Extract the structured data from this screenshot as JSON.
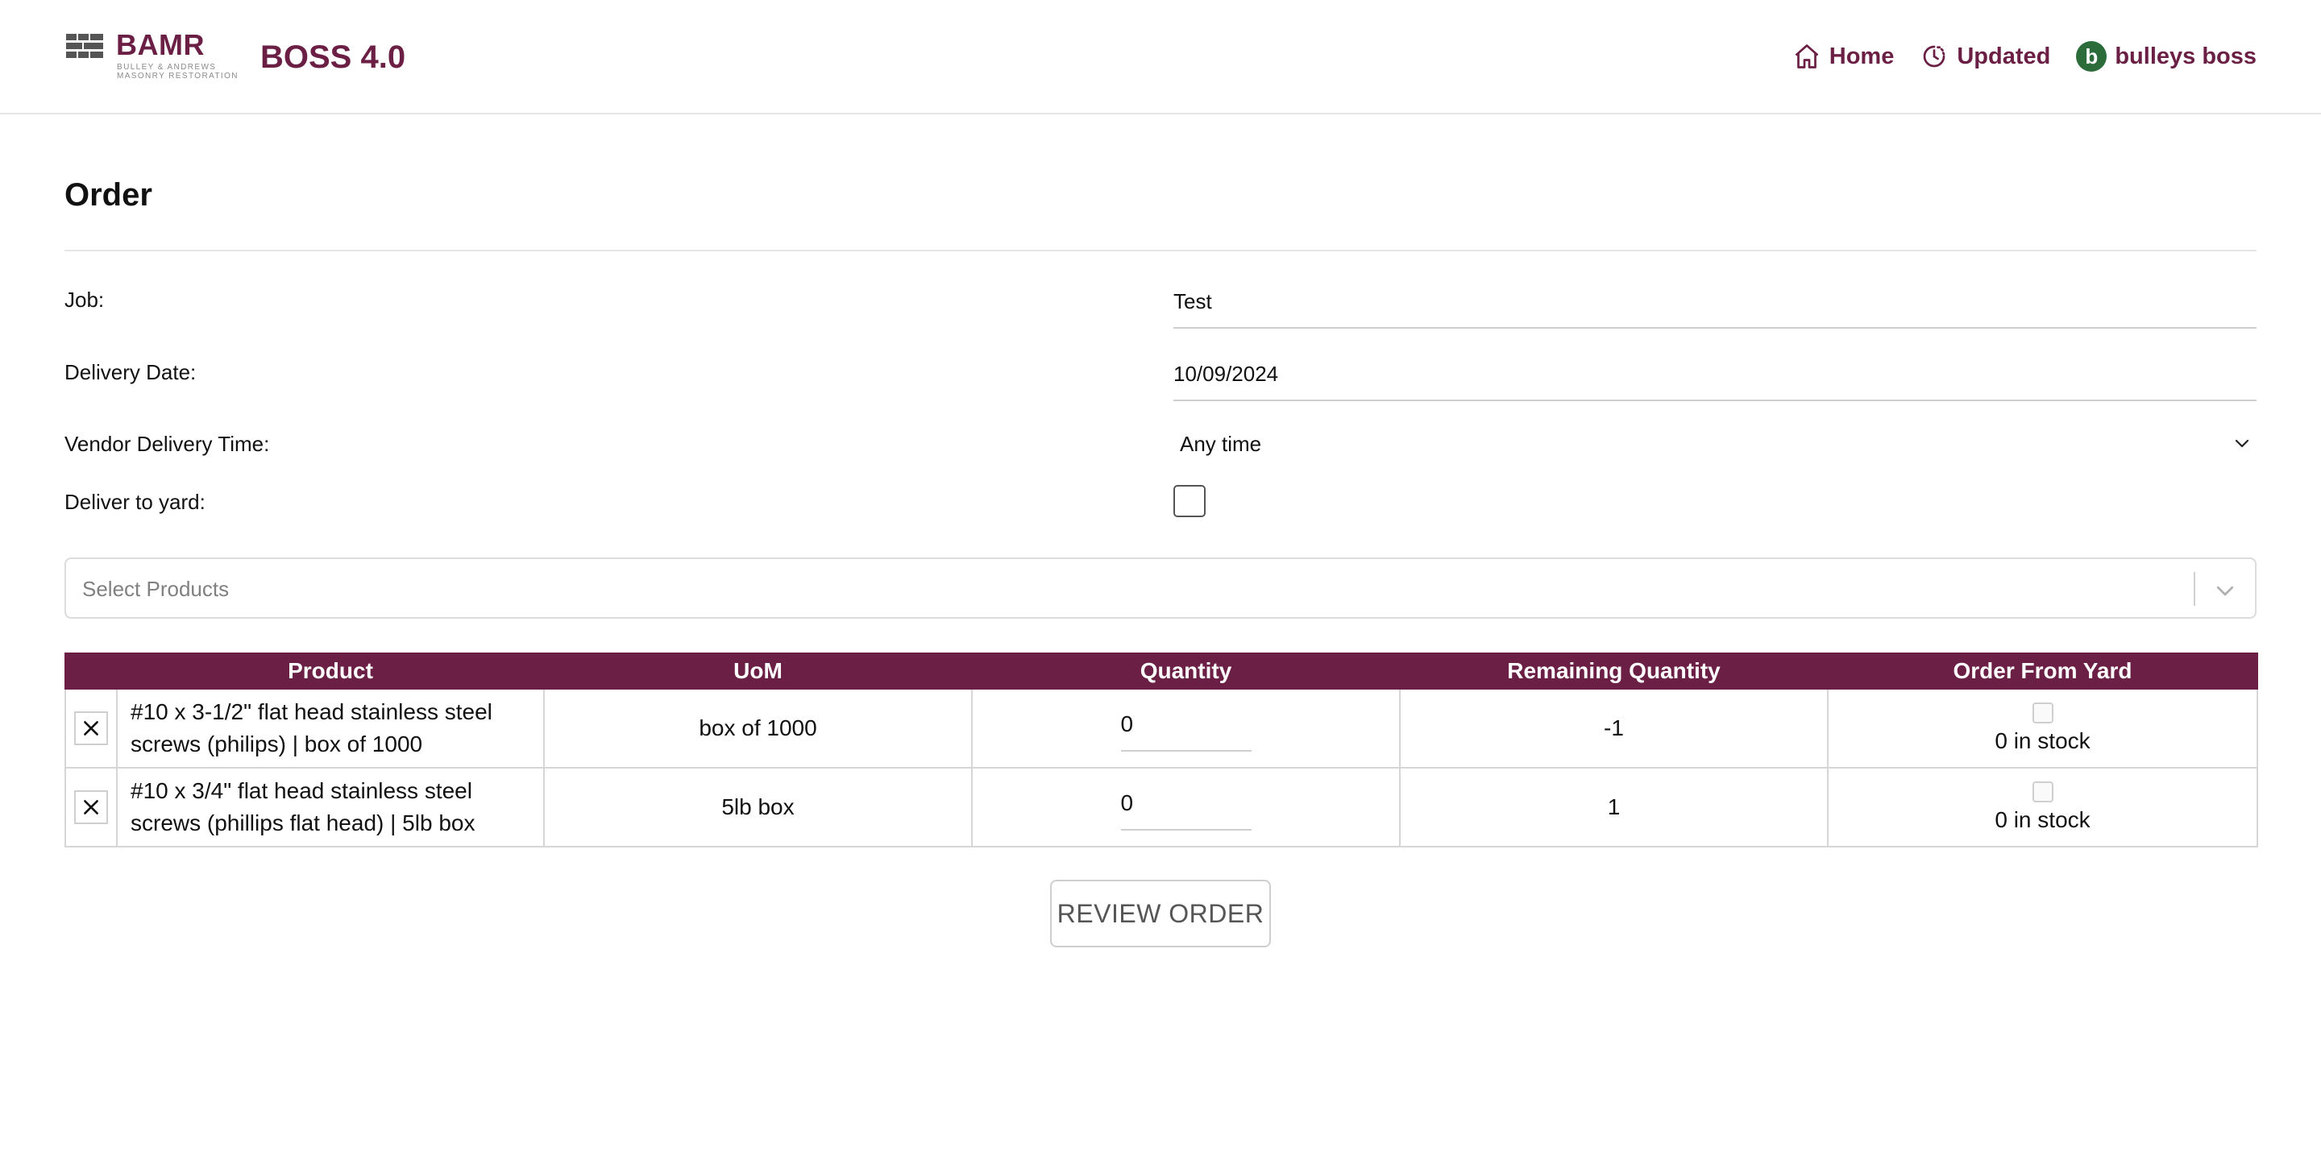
{
  "header": {
    "logo_text": "BAMR",
    "logo_sub1": "BULLEY & ANDREWS",
    "logo_sub2": "MASONRY RESTORATION",
    "app_title": "BOSS 4.0",
    "nav": {
      "home_label": "Home",
      "updated_label": "Updated",
      "user_initial": "b",
      "user_name": "bulleys boss"
    }
  },
  "page": {
    "title": "Order"
  },
  "form": {
    "job_label": "Job:",
    "job_value": "Test",
    "delivery_date_label": "Delivery Date:",
    "delivery_date_value": "10/09/2024",
    "vendor_time_label": "Vendor Delivery Time:",
    "vendor_time_value": "Any time",
    "deliver_yard_label": "Deliver to yard:",
    "deliver_yard_checked": false
  },
  "product_select": {
    "placeholder": "Select Products"
  },
  "table": {
    "headers": [
      "",
      "Product",
      "UoM",
      "Quantity",
      "Remaining Quantity",
      "Order From Yard"
    ],
    "rows": [
      {
        "product": "#10 x 3-1/2\" flat head stainless steel screws (philips) | box of 1000",
        "uom": "box of 1000",
        "quantity": "0",
        "remaining": "-1",
        "stock": "0 in stock"
      },
      {
        "product": "#10 x 3/4\" flat head stainless steel screws (phillips flat head) | 5lb box",
        "uom": "5lb box",
        "quantity": "0",
        "remaining": "1",
        "stock": "0 in stock"
      }
    ]
  },
  "actions": {
    "review_label": "REVIEW ORDER"
  },
  "colors": {
    "brand": "#6b1f44",
    "avatar": "#2c6b3a"
  }
}
